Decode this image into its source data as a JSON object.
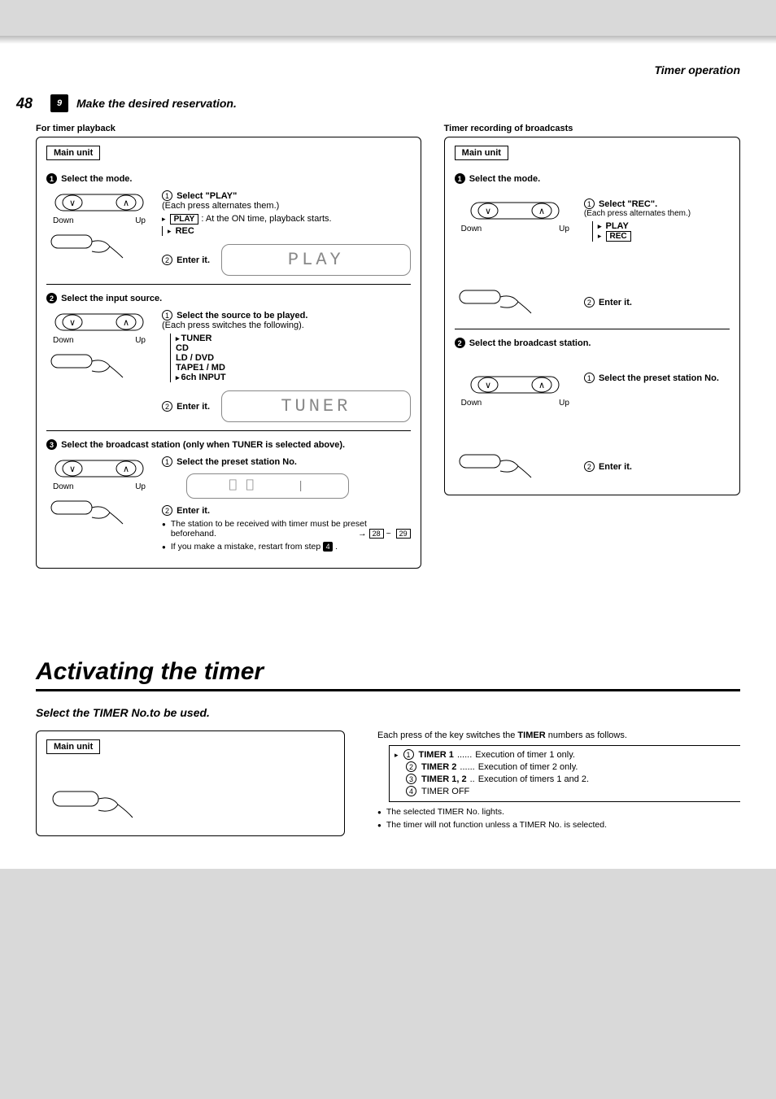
{
  "header": {
    "section": "Timer operation"
  },
  "page_number": "48",
  "step": {
    "num": "9",
    "title": "Make the desired reservation."
  },
  "playback": {
    "heading": "For timer playback",
    "main_unit": "Main unit",
    "s1": {
      "title_num": "1",
      "title": "Select the mode.",
      "i1_num": "1",
      "i1": "Select \"PLAY\"",
      "i1_note": "(Each press alternates them.)",
      "play_box": "PLAY",
      "play_note": ": At the ON time, playback starts.",
      "rec": "REC",
      "i2_num": "2",
      "i2": "Enter it.",
      "down": "Down",
      "up": "Up",
      "display": "PLAY"
    },
    "s2": {
      "title_num": "2",
      "title": "Select the input source.",
      "i1_num": "1",
      "i1": "Select the source to be played.",
      "i1_note": "(Each press switches the following).",
      "opts": [
        "TUNER",
        "CD",
        "LD / DVD",
        "TAPE1 / MD",
        "6ch INPUT"
      ],
      "i2_num": "2",
      "i2": "Enter it.",
      "down": "Down",
      "up": "Up",
      "display": "TUNER"
    },
    "s3": {
      "title_num": "3",
      "title": "Select the broadcast station (only when TUNER is selected above).",
      "i1_num": "1",
      "i1": "Select the preset station No.",
      "i2_num": "2",
      "i2": "Enter it.",
      "down": "Down",
      "up": "Up",
      "note1": "The station to be received with timer must be preset beforehand.",
      "note1_pg_a": "28",
      "note1_pg_b": "29",
      "note2_a": "If you make a mistake, restart from step ",
      "note2_step": "4",
      "note2_b": " ."
    }
  },
  "recording": {
    "heading": "Timer recording of broadcasts",
    "main_unit": "Main unit",
    "s1": {
      "title_num": "1",
      "title": "Select the mode.",
      "i1_num": "1",
      "i1": "Select \"REC\".",
      "i1_note": "(Each press alternates them.)",
      "play": "PLAY",
      "rec_box": "REC",
      "i2_num": "2",
      "i2": "Enter it.",
      "down": "Down",
      "up": "Up"
    },
    "s2": {
      "title_num": "2",
      "title": "Select the broadcast station.",
      "i1_num": "1",
      "i1": "Select the preset station No.",
      "i2_num": "2",
      "i2": "Enter it.",
      "down": "Down",
      "up": "Up"
    }
  },
  "section2": {
    "title": "Activating the timer",
    "subtitle": "Select the TIMER  No.to be used.",
    "main_unit": "Main unit",
    "intro_a": "Each press of the key switches the ",
    "intro_b": "TIMER",
    "intro_c": " numbers as follows.",
    "items": [
      {
        "n": "1",
        "label": "TIMER 1",
        "dots": " ...... ",
        "desc": "Execution of timer 1 only."
      },
      {
        "n": "2",
        "label": "TIMER 2",
        "dots": " ...... ",
        "desc": "Execution of timer 2 only."
      },
      {
        "n": "3",
        "label": "TIMER 1, 2",
        "dots": " .. ",
        "desc": "Execution of timers 1 and 2."
      },
      {
        "n": "4",
        "label": "TIMER OFF",
        "dots": "",
        "desc": ""
      }
    ],
    "note1": "The selected TIMER No. lights.",
    "note2": "The timer will not function unless a TIMER No. is selected."
  }
}
